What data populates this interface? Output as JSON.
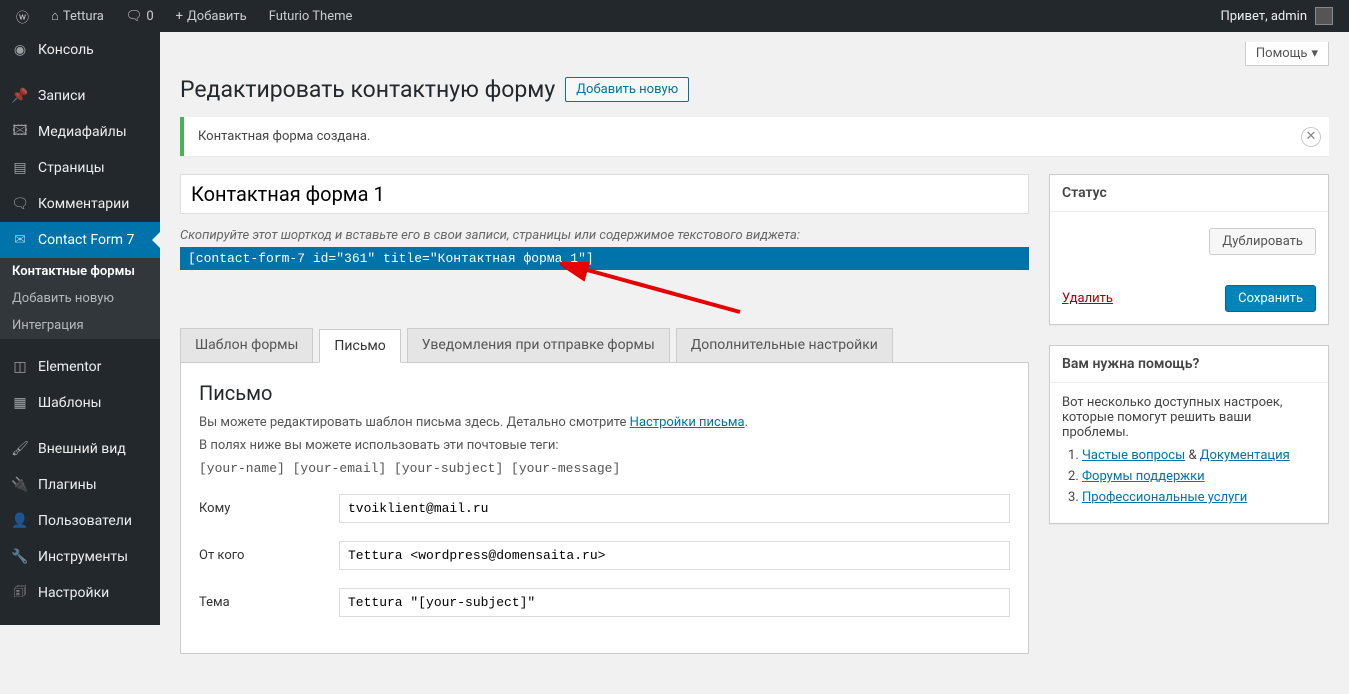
{
  "topbar": {
    "site_name": "Tettura",
    "comments_count": "0",
    "add_new": "Добавить",
    "theme_link": "Futurio Theme",
    "greeting": "Привет, admin"
  },
  "sidebar": {
    "items": [
      {
        "icon": "dashboard",
        "label": "Консоль"
      },
      {
        "icon": "pin",
        "label": "Записи"
      },
      {
        "icon": "media",
        "label": "Медиафайлы"
      },
      {
        "icon": "page",
        "label": "Страницы"
      },
      {
        "icon": "comment",
        "label": "Комментарии"
      },
      {
        "icon": "mail",
        "label": "Contact Form 7",
        "current": true
      },
      {
        "icon": "elementor",
        "label": "Elementor"
      },
      {
        "icon": "templates",
        "label": "Шаблоны"
      },
      {
        "icon": "brush",
        "label": "Внешний вид"
      },
      {
        "icon": "plugin",
        "label": "Плагины"
      },
      {
        "icon": "users",
        "label": "Пользователи"
      },
      {
        "icon": "tools",
        "label": "Инструменты"
      },
      {
        "icon": "settings",
        "label": "Настройки"
      }
    ],
    "submenu": [
      {
        "label": "Контактные формы",
        "current": true
      },
      {
        "label": "Добавить новую"
      },
      {
        "label": "Интеграция"
      }
    ]
  },
  "help_tab": "Помощь",
  "page": {
    "title": "Редактировать контактную форму",
    "add_new": "Добавить новую"
  },
  "notice": {
    "text": "Контактная форма создана."
  },
  "form": {
    "title_value": "Контактная форма 1",
    "shortcode_desc": "Скопируйте этот шорткод и вставьте его в свои записи, страницы или содержимое текстового виджета:",
    "shortcode": "[contact-form-7 id=\"361\" title=\"Контактная форма 1\"]"
  },
  "tabs": [
    {
      "label": "Шаблон формы"
    },
    {
      "label": "Письмо",
      "active": true
    },
    {
      "label": "Уведомления при отправке формы"
    },
    {
      "label": "Дополнительные настройки"
    }
  ],
  "mail_panel": {
    "heading": "Письмо",
    "help_prefix": "Вы можете редактировать шаблон письма здесь. Детально смотрите ",
    "help_link": "Настройки письма",
    "help_suffix": ".",
    "tags_intro": "В полях ниже вы можете использовать эти почтовые теги:",
    "tags": "[your-name] [your-email] [your-subject] [your-message]",
    "fields": {
      "to_label": "Кому",
      "to_value": "tvoiklient@mail.ru",
      "from_label": "От кого",
      "from_value": "Tettura <wordpress@domensaita.ru>",
      "subject_label": "Тема",
      "subject_value": "Tettura \"[your-subject]\""
    }
  },
  "sidebox": {
    "status_title": "Статус",
    "duplicate": "Дублировать",
    "delete": "Удалить",
    "save": "Сохранить",
    "help_title": "Вам нужна помощь?",
    "help_text": "Вот несколько доступных настроек, которые помогут решить ваши проблемы.",
    "links": {
      "faq": "Частые вопросы",
      "amp": "&",
      "docs": "Документация",
      "forum": "Форумы поддержки",
      "pro": "Профессиональные услуги"
    }
  }
}
